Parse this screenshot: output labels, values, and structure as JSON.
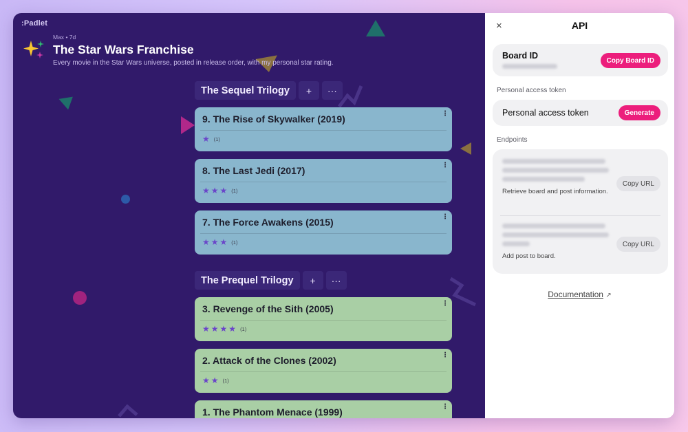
{
  "app": {
    "logo": ":Padlet"
  },
  "board": {
    "author": "Max",
    "age": "• 7d",
    "title": "The Star Wars Franchise",
    "description": "Every movie in the Star Wars universe, posted in release order, with my personal star rating."
  },
  "sections": [
    {
      "title": "The Sequel Trilogy",
      "add_label": "+",
      "more_label": "···",
      "color": "#89b6cd",
      "posts": [
        {
          "title": "9. The Rise of Skywalker (2019)",
          "stars": 1,
          "count": "(1)"
        },
        {
          "title": "8. The Last Jedi (2017)",
          "stars": 3,
          "count": "(1)"
        },
        {
          "title": "7. The Force Awakens (2015)",
          "stars": 3,
          "count": "(1)"
        }
      ]
    },
    {
      "title": "The Prequel Trilogy",
      "add_label": "+",
      "more_label": "···",
      "color": "#a9cfa5",
      "posts": [
        {
          "title": "3. Revenge of the Sith (2005)",
          "stars": 4,
          "count": "(1)"
        },
        {
          "title": "2. Attack of the Clones (2002)",
          "stars": 2,
          "count": "(1)"
        },
        {
          "title": "1. The Phantom Menace (1999)"
        }
      ]
    }
  ],
  "api_panel": {
    "close_icon": "×",
    "title": "API",
    "board_id_label": "Board ID",
    "copy_board_id": "Copy Board ID",
    "pat_section_label": "Personal access token",
    "pat_label": "Personal access token",
    "generate": "Generate",
    "endpoints_label": "Endpoints",
    "endpoints": [
      {
        "copy": "Copy URL",
        "description": "Retrieve board and post information."
      },
      {
        "copy": "Copy URL",
        "description": "Add post to board."
      }
    ],
    "documentation": "Documentation",
    "external_icon": "↗"
  },
  "colors": {
    "board_bg": "#311a6a",
    "accent": "#ec1e7c",
    "star": "#6a45c9"
  }
}
